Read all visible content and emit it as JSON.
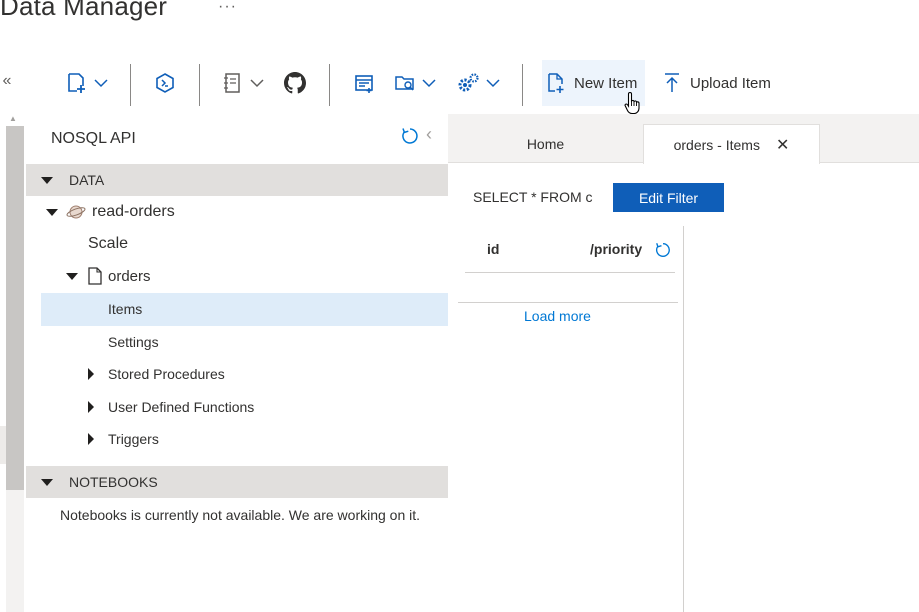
{
  "app": {
    "title": "Data Manager",
    "more": "···"
  },
  "toolbar": {
    "collapse_glyph": "«",
    "new_item_label": "New Item",
    "upload_item_label": "Upload Item",
    "icons": [
      "new-container-icon",
      "cosmos-terminal-icon",
      "new-notebook-icon",
      "github-icon",
      "new-sql-query-icon",
      "open-folder-icon",
      "settings-gear-icon",
      "new-file-icon",
      "upload-icon"
    ]
  },
  "tree": {
    "header": "NOSQL API",
    "data_section": "DATA",
    "database": "read-orders",
    "scale": "Scale",
    "container": "orders",
    "items": "Items",
    "settings": "Settings",
    "stored_procedures": "Stored Procedures",
    "udfs": "User Defined Functions",
    "triggers": "Triggers",
    "notebooks_section": "NOTEBOOKS",
    "notebooks_message": "Notebooks is currently not available. We are working on it."
  },
  "tabs": {
    "home": "Home",
    "active": "orders - Items",
    "close": "✕"
  },
  "query": {
    "text": "SELECT * FROM c",
    "edit_filter": "Edit Filter"
  },
  "documents": {
    "col_id": "id",
    "col_partition_key": "/priority",
    "load_more": "Load more"
  },
  "colors": {
    "accent": "#0078d4",
    "button_bg": "#0f5eb8",
    "selected": "#deecf9",
    "section_bg": "#e1dfdd"
  }
}
